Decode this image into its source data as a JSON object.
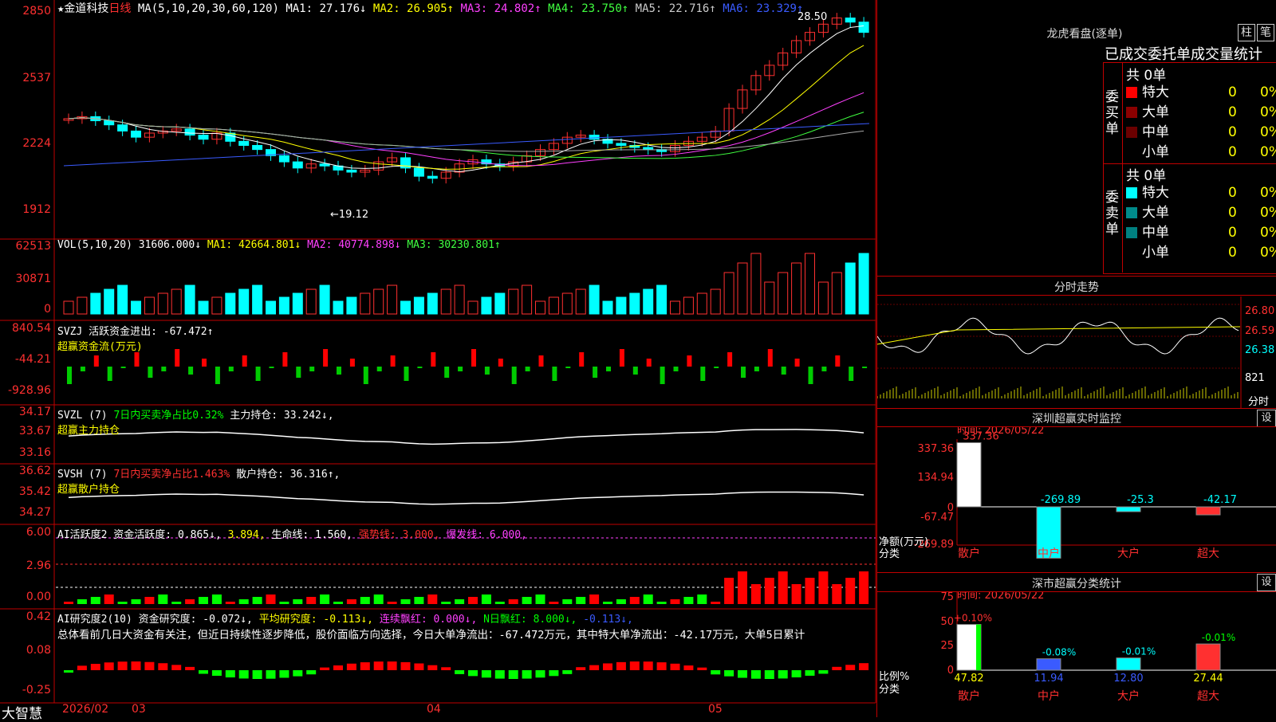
{
  "header": {
    "stock_label": "★金道科技",
    "period": "日线",
    "ma_label": "MA(5,10,20,30,60,120)",
    "ma_items": [
      {
        "text": "MA1: 27.176↓",
        "color": "#ffffff"
      },
      {
        "text": "MA2: 26.905↑",
        "color": "#ffff00"
      },
      {
        "text": "MA3: 24.802↑",
        "color": "#ff40ff"
      },
      {
        "text": "MA4: 23.750↑",
        "color": "#40ff40"
      },
      {
        "text": "MA5: 22.716↑",
        "color": "#cccccc"
      },
      {
        "text": "MA6: 23.329↑",
        "color": "#3a5bff"
      }
    ],
    "high_label": "28.50",
    "low_label": "←19.12"
  },
  "main_axis": [
    "2850",
    "2537",
    "2224",
    "1912"
  ],
  "vol": {
    "title": "VOL(5,10,20)",
    "items": [
      {
        "text": "31606.000↓",
        "color": "#ffffff"
      },
      {
        "text": "MA1: 42664.801↓",
        "color": "#ffff00"
      },
      {
        "text": "MA2: 40774.898↓",
        "color": "#ff40ff"
      },
      {
        "text": "MA3: 30230.801↑",
        "color": "#40ff40"
      }
    ],
    "axis": [
      "62513",
      "30871",
      "0"
    ]
  },
  "svzj": {
    "title": "SVZJ  活跃资金进出: -67.472↑",
    "subtitle": "超赢资金流(万元)",
    "axis": [
      "840.54",
      "-44.21",
      "-928.96"
    ]
  },
  "svzl": {
    "title": "SVZL (7)",
    "green_text": "7日内买卖净占比0.32%",
    "white_text": "主力持仓: 33.242↓,",
    "subtitle": "超赢主力持仓",
    "axis": [
      "34.17",
      "33.67",
      "33.16"
    ]
  },
  "svsh": {
    "title": "SVSH (7)",
    "red_text": "7日内买卖净占比1.463%",
    "white_text": "散户持仓: 36.316↑,",
    "subtitle": "超赢散户持仓",
    "axis": [
      "36.62",
      "35.42",
      "34.27"
    ]
  },
  "ai2": {
    "title": "AI活跃度2 资金活跃度: 0.865↓,",
    "v2": "3.894,",
    "life": "生命线: 1.560,",
    "strong": "强势线: 3.000,",
    "burst": "爆发线: 6.000,",
    "axis": [
      "6.00",
      "2.96",
      "0.00"
    ]
  },
  "ai_research": {
    "title": "AI研究度2(10)  资金研究度: -0.072↓,",
    "avg": "平均研究度: -0.113↓,",
    "cont": "连续飘红: 0.000↓,",
    "nday": "N日飘红: 8.000↓,",
    "last": "-0.113↓,",
    "desc": "总体看前几日大资金有关注，但近日持续性逐步降低，股价面临方向选择，今日大单净流出：-67.472万元，其中特大单净流出：-42.17万元，大单5日累计",
    "axis": [
      "0.42",
      "0.08",
      "-0.25"
    ]
  },
  "bottom": {
    "brand": "大智慧",
    "dates": [
      "2026/02",
      "03",
      "04",
      "05"
    ]
  },
  "right": {
    "longhu_title": "龙虎看盘(逐单)",
    "btn_zhu": "柱",
    "btn_bi": "笔",
    "tabs": "已成交委托单成交量统计",
    "buy_label": "委买单",
    "sell_label": "委卖单",
    "buy_total": "共 0单",
    "sell_total": "共 0单",
    "buy_rows": [
      {
        "name": "特大",
        "n": "0",
        "p": "0%",
        "color": "#ff0000"
      },
      {
        "name": "大单",
        "n": "0",
        "p": "0%",
        "color": "#8b0000"
      },
      {
        "name": "中单",
        "n": "0",
        "p": "0%",
        "color": "#6b0000"
      },
      {
        "name": "小单",
        "n": "0",
        "p": "0%",
        "color": ""
      }
    ],
    "sell_rows": [
      {
        "name": "特大",
        "n": "0",
        "p": "0%",
        "color": "#00ffff"
      },
      {
        "name": "大单",
        "n": "0",
        "p": "0%",
        "color": "#008b8b"
      },
      {
        "name": "中单",
        "n": "0",
        "p": "0%",
        "color": "#008080"
      },
      {
        "name": "小单",
        "n": "0",
        "p": "0%",
        "color": ""
      }
    ],
    "fenshi_title": "分时走势",
    "fenshi_axis": [
      "26.80",
      "26.59",
      "26.38",
      "821"
    ],
    "fenshi_bottom": "分时",
    "monitor_title": "深圳超赢实时监控",
    "monitor_btn": "设",
    "monitor_time": "时间: 2026/05/22",
    "monitor_axis": [
      "337.36",
      "134.94",
      "0",
      "-67.47",
      "-269.89"
    ],
    "monitor_net": "净额(万元)",
    "monitor_cat": "分类",
    "monitor_values": [
      "337.36",
      "-269.89",
      "-25.3",
      "-42.17"
    ],
    "categories": [
      "散户",
      "中户",
      "大户",
      "超大"
    ],
    "stat_title": "深市超赢分类统计",
    "stat_btn": "设",
    "stat_time": "时间: 2026/05/22",
    "stat_axis": [
      "75",
      "50",
      "25",
      "0"
    ],
    "stat_pct": [
      "+0.10%",
      "-0.08%",
      "-0.01%",
      "-0.01%"
    ],
    "stat_values": [
      "47.82",
      "11.94",
      "12.80",
      "27.44"
    ],
    "stat_ratio": "比例%",
    "stat_cat": "分类"
  }
}
